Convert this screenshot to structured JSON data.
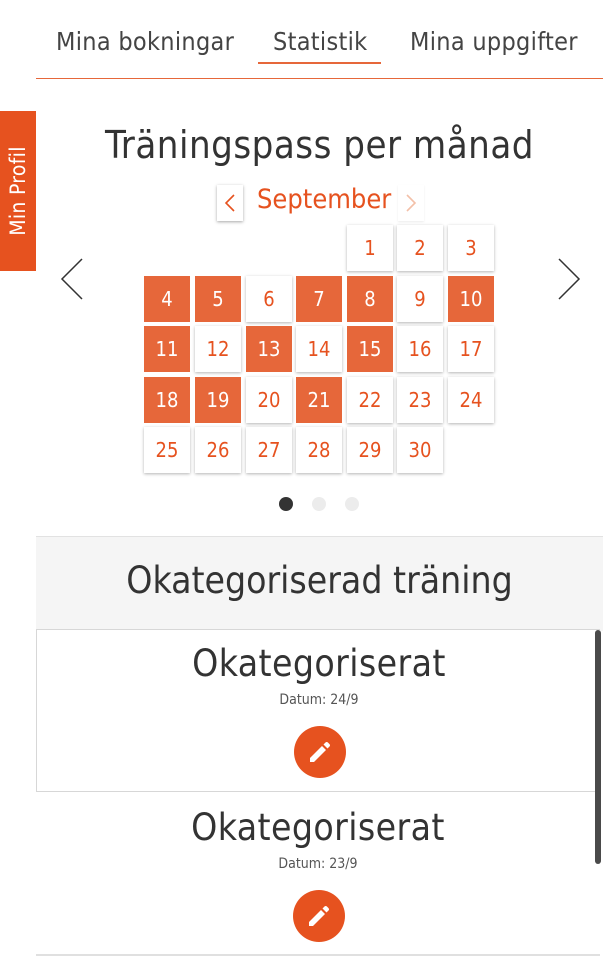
{
  "tabs": [
    {
      "label": "Mina bokningar",
      "active": false
    },
    {
      "label": "Statistik",
      "active": true
    },
    {
      "label": "Mina uppgifter",
      "active": false
    }
  ],
  "profile_tab": {
    "label": "Min Profil"
  },
  "stats": {
    "title": "Träningspass per månad",
    "month": "September",
    "month_prev_icon": "chevron-left-icon",
    "month_next_icon": "chevron-right-icon",
    "days": [
      "1",
      "2",
      "3",
      "4",
      "5",
      "6",
      "7",
      "8",
      "9",
      "10",
      "11",
      "12",
      "13",
      "14",
      "15",
      "16",
      "17",
      "18",
      "19",
      "20",
      "21",
      "22",
      "23",
      "24",
      "25",
      "26",
      "27",
      "28",
      "29",
      "30"
    ],
    "trained_days": [
      4,
      5,
      7,
      8,
      10,
      11,
      13,
      15,
      18,
      19,
      21
    ],
    "carousel_dots": 3,
    "active_dot": 0
  },
  "section": {
    "title": "Okategoriserad träning"
  },
  "entries": [
    {
      "name": "Okategoriserat",
      "date": "Datum: 24/9"
    },
    {
      "name": "Okategoriserat",
      "date": "Datum: 23/9"
    }
  ],
  "colors": {
    "accent": "#e6521f",
    "accent_light": "#e6673a"
  }
}
